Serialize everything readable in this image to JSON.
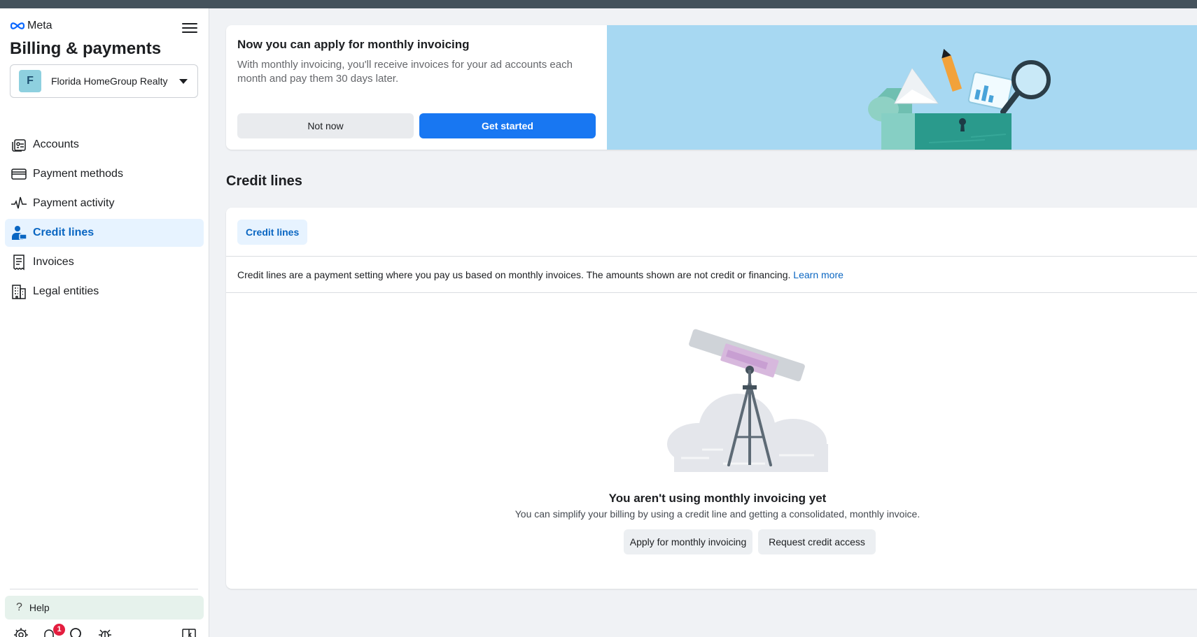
{
  "brand": {
    "name": "Meta",
    "icon": "meta-infinity-icon"
  },
  "header": {
    "title": "Billing & payments",
    "menu_icon": "hamburger-menu-icon"
  },
  "account_selector": {
    "initial": "F",
    "name": "Florida HomeGroup Realty",
    "icon": "caret-down-icon"
  },
  "sidebar": {
    "items": [
      {
        "label": "Accounts",
        "icon": "accounts-icon"
      },
      {
        "label": "Payment methods",
        "icon": "credit-card-icon"
      },
      {
        "label": "Payment activity",
        "icon": "activity-pulse-icon"
      },
      {
        "label": "Credit lines",
        "icon": "credit-lines-icon",
        "active": true
      },
      {
        "label": "Invoices",
        "icon": "invoice-icon"
      },
      {
        "label": "Legal entities",
        "icon": "building-icon"
      }
    ],
    "help_label": "Help",
    "bottom_icons": [
      "settings-gear-icon",
      "notifications-bell-icon",
      "search-icon",
      "bug-report-icon",
      "panel-toggle-icon"
    ],
    "notification_count": "1"
  },
  "promo": {
    "title": "Now you can apply for monthly invoicing",
    "description": "With monthly invoicing, you'll receive invoices for your ad accounts each month and pay them 30 days later.",
    "not_now_label": "Not now",
    "get_started_label": "Get started"
  },
  "main": {
    "section_title": "Credit lines",
    "tab_label": "Credit lines",
    "description": "Credit lines are a payment setting where you pay us based on monthly invoices. The amounts shown are not credit or financing.",
    "learn_more": "Learn more",
    "empty_title": "You aren't using monthly invoicing yet",
    "empty_subtitle": "You can simplify your billing by using a credit line and getting a consolidated, monthly invoice.",
    "apply_label": "Apply for monthly invoicing",
    "request_label": "Request credit access"
  },
  "colors": {
    "accent": "#1877f2",
    "active_bg": "#e7f3ff",
    "active_text": "#0a66c2",
    "promo_bg": "#a7d8f2",
    "help_bg": "#e6f2ec",
    "topbar": "#44525c"
  }
}
